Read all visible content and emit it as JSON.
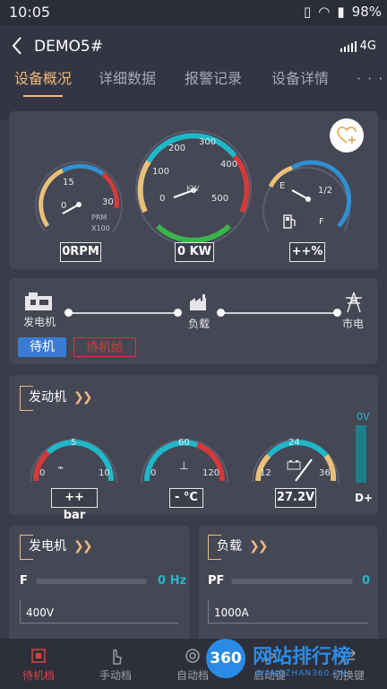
{
  "status_bar": {
    "time": "10:05",
    "battery": "98%"
  },
  "header": {
    "device_name": "DEMO5#",
    "network": "4G"
  },
  "tabs": [
    "设备概况",
    "详细数据",
    "报警记录",
    "设备详情",
    "· · ·"
  ],
  "gauges_top": {
    "rpm": {
      "ticks": [
        "15",
        "30",
        "0"
      ],
      "unit1": "PRM",
      "unit2": "X100",
      "value": "0RPM"
    },
    "power": {
      "ticks": [
        "100",
        "200",
        "300",
        "400",
        "500",
        "0"
      ],
      "unit": "KW",
      "value": "0 KW"
    },
    "fuel": {
      "ticks": [
        "E",
        "1/2",
        "F"
      ],
      "value": "++%"
    }
  },
  "flow": {
    "generator": "发电机",
    "load": "负载",
    "grid": "市电",
    "standby": "待机",
    "ready": "待机给"
  },
  "engine": {
    "title": "发动机",
    "oil": {
      "ticks": [
        "0",
        "5",
        "10"
      ],
      "value": "++ bar"
    },
    "temp": {
      "ticks": [
        "0",
        "60",
        "120"
      ],
      "value": "- °C"
    },
    "battery": {
      "ticks": [
        "12",
        "24",
        "36"
      ],
      "value": "27.2V"
    },
    "dplus": {
      "top": "0V",
      "label": "D+"
    }
  },
  "generator_panel": {
    "title": "发电机",
    "freq_label": "F",
    "freq_value": "0 Hz",
    "voltage": "400V"
  },
  "load_panel": {
    "title": "负载",
    "pf_label": "PF",
    "pf_value": "0",
    "current": "1000A"
  },
  "bottom_nav": [
    "待机档",
    "手动档",
    "自动档",
    "启动键",
    "切换键"
  ],
  "watermark": {
    "big": "网站排行榜",
    "small": "WANGZHAN360.CN",
    "badge": "360"
  }
}
